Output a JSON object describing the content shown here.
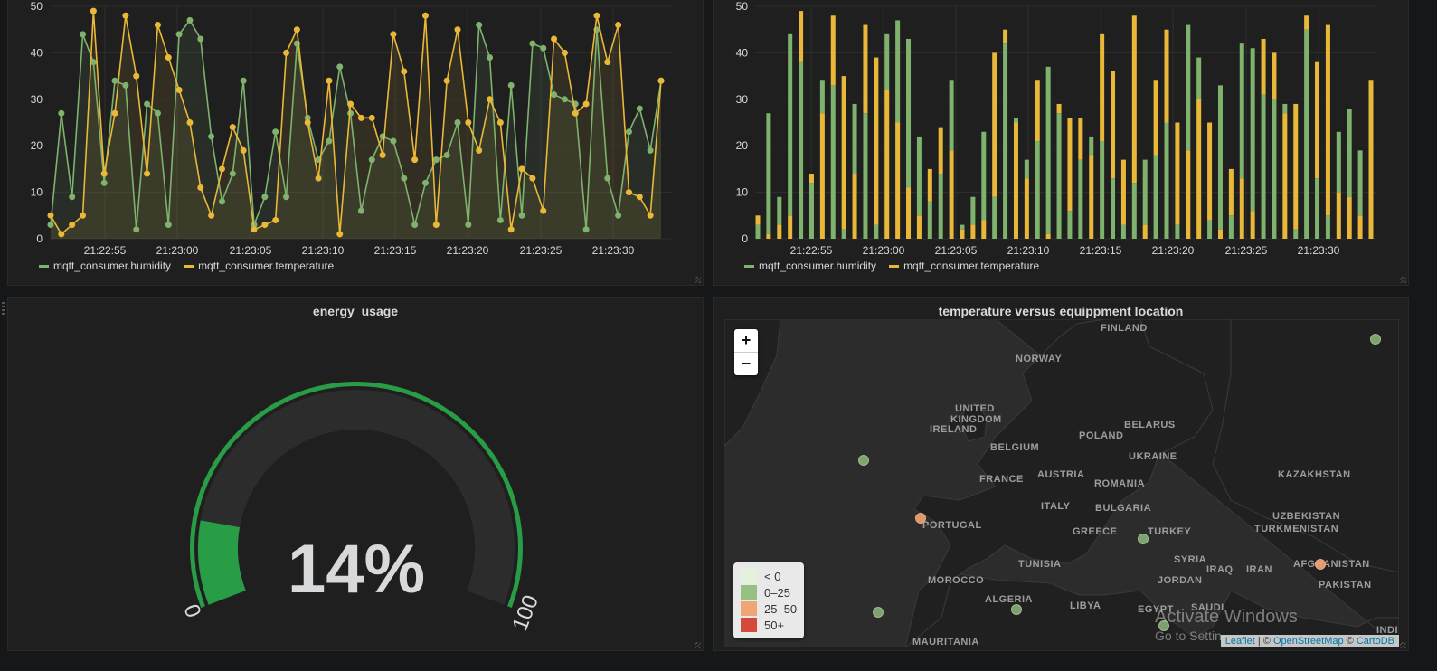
{
  "line_panel": {
    "legend": [
      {
        "label": "mqtt_consumer.humidity",
        "color": "#7eb26d"
      },
      {
        "label": "mqtt_consumer.temperature",
        "color": "#eab839"
      }
    ]
  },
  "bar_panel": {
    "legend": [
      {
        "label": "mqtt_consumer.humidity",
        "color": "#7eb26d"
      },
      {
        "label": "mqtt_consumer.temperature",
        "color": "#eab839"
      }
    ]
  },
  "chart_data": [
    {
      "type": "line",
      "y_ticks": [
        0,
        10,
        20,
        30,
        40,
        50
      ],
      "ylim": [
        0,
        50
      ],
      "x_tick_labels": [
        "21:22:55",
        "21:23:00",
        "21:23:05",
        "21:23:10",
        "21:23:15",
        "21:23:20",
        "21:23:25",
        "21:23:30"
      ],
      "grid": true,
      "legend_placement": "bottom-left",
      "series": [
        {
          "name": "mqtt_consumer.humidity",
          "color": "#7eb26d",
          "values": [
            3,
            27,
            9,
            44,
            38,
            12,
            34,
            33,
            2,
            29,
            27,
            3,
            44,
            47,
            43,
            22,
            8,
            14,
            34,
            3,
            9,
            23,
            9,
            42,
            26,
            17,
            21,
            37,
            27,
            6,
            17,
            22,
            21,
            13,
            3,
            12,
            17,
            18,
            25,
            3,
            46,
            39,
            4,
            33,
            5,
            42,
            41,
            31,
            30,
            29,
            2,
            45,
            13,
            5,
            23,
            28,
            19,
            34
          ]
        },
        {
          "name": "mqtt_consumer.temperature",
          "color": "#eab839",
          "values": [
            5,
            1,
            3,
            5,
            49,
            14,
            27,
            48,
            35,
            14,
            46,
            39,
            32,
            25,
            11,
            5,
            15,
            24,
            19,
            2,
            3,
            4,
            40,
            45,
            25,
            13,
            34,
            1,
            29,
            26,
            26,
            18,
            44,
            36,
            17,
            48,
            3,
            34,
            45,
            25,
            19,
            30,
            25,
            2,
            15,
            13,
            6,
            43,
            40,
            27,
            29,
            48,
            38,
            46,
            10,
            9,
            5,
            34
          ]
        }
      ]
    },
    {
      "type": "bar",
      "stacked": true,
      "y_ticks": [
        0,
        10,
        20,
        30,
        40,
        50
      ],
      "ylim": [
        0,
        50
      ],
      "x_tick_labels": [
        "21:22:55",
        "21:23:00",
        "21:23:05",
        "21:23:10",
        "21:23:15",
        "21:23:20",
        "21:23:25",
        "21:23:30"
      ],
      "grid": true,
      "legend_placement": "bottom-left",
      "series": [
        {
          "name": "mqtt_consumer.humidity",
          "color": "#7eb26d",
          "values": [
            3,
            27,
            9,
            44,
            38,
            12,
            34,
            33,
            2,
            29,
            27,
            3,
            44,
            47,
            43,
            22,
            8,
            14,
            34,
            3,
            9,
            23,
            9,
            42,
            26,
            17,
            21,
            37,
            27,
            6,
            17,
            22,
            21,
            13,
            3,
            12,
            17,
            18,
            25,
            3,
            46,
            39,
            4,
            33,
            5,
            42,
            41,
            31,
            30,
            29,
            2,
            45,
            13,
            5,
            23,
            28,
            19,
            34
          ]
        },
        {
          "name": "mqtt_consumer.temperature",
          "color": "#eab839",
          "values": [
            5,
            1,
            3,
            5,
            49,
            14,
            27,
            48,
            35,
            14,
            46,
            39,
            32,
            25,
            11,
            5,
            15,
            24,
            19,
            2,
            3,
            4,
            40,
            45,
            25,
            13,
            34,
            1,
            29,
            26,
            26,
            18,
            44,
            36,
            17,
            48,
            3,
            34,
            45,
            25,
            19,
            30,
            25,
            2,
            15,
            13,
            6,
            43,
            40,
            27,
            29,
            48,
            38,
            46,
            10,
            9,
            5,
            34
          ]
        }
      ]
    }
  ],
  "gauge": {
    "title": "energy_usage",
    "value_text": "14%",
    "value": 14,
    "min_label": "0",
    "max_label": "100",
    "color": "#299c46"
  },
  "map_panel": {
    "title": "temperature versus equippment location",
    "zoom_in": "+",
    "zoom_out": "−",
    "legend": [
      {
        "label": "< 0",
        "color": "#e3f2d9"
      },
      {
        "label": "0–25",
        "color": "#96c184"
      },
      {
        "label": "25–50",
        "color": "#f0a577"
      },
      {
        "label": "50+",
        "color": "#d44a3a"
      }
    ],
    "attribution": {
      "leaflet": "Leaflet",
      "sep1": " | © ",
      "osm": "OpenStreetMap",
      "sep2": " © ",
      "carto": "CartoDB"
    },
    "countries": [
      "FINLAND",
      "NORWAY",
      "UNITED",
      "KINGDOM",
      "IRELAND",
      "BELARUS",
      "POLAND",
      "BELGIUM",
      "UKRAINE",
      "FRANCE",
      "AUSTRIA",
      "ROMANIA",
      "KAZAKHSTAN",
      "ITALY",
      "BULGARIA",
      "UZBEKISTAN",
      "PORTUGAL",
      "GREECE",
      "TURKEY",
      "TURKMENISTAN",
      "TUNISIA",
      "SYRIA",
      "IRAQ",
      "IRAN",
      "AFGHANISTAN",
      "MOROCCO",
      "JORDAN",
      "PAKISTAN",
      "ALGERIA",
      "LIBYA",
      "EGYPT",
      "SAUDI",
      "MAURITANIA",
      "INDI"
    ],
    "watermark": "Activate Windows",
    "watermark_sub": "Go to Settin"
  }
}
